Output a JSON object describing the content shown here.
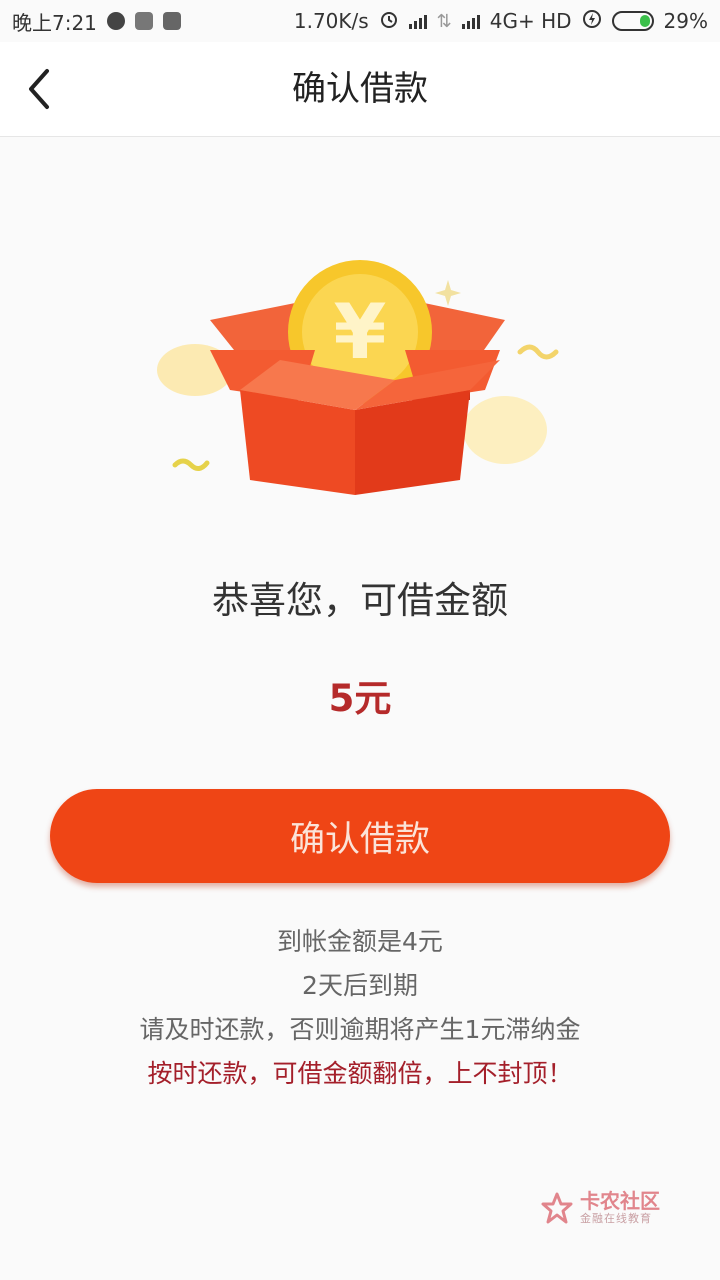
{
  "status_bar": {
    "time": "晚上7:21",
    "speed": "1.70K/s",
    "network": "4G+ HD",
    "battery": "29%"
  },
  "nav": {
    "title": "确认借款",
    "back_icon": "chevron-left-icon"
  },
  "illustration": {
    "coin_symbol": "¥",
    "accent": "#ef4515",
    "coin_color": "#f4c52a"
  },
  "main": {
    "congrats_text": "恭喜您，可借金额",
    "amount": "5元"
  },
  "confirm_button": {
    "label": "确认借款",
    "color": "#ef4515"
  },
  "info": {
    "line1": "到帐金额是4元",
    "line2": "2天后到期",
    "line3": "请及时还款，否则逾期将产生1元滞纳金",
    "line4": "按时还款，可借金额翻倍，上不封顶！"
  },
  "watermark": {
    "name": "卡农社区",
    "sub": "金融在线教育"
  }
}
